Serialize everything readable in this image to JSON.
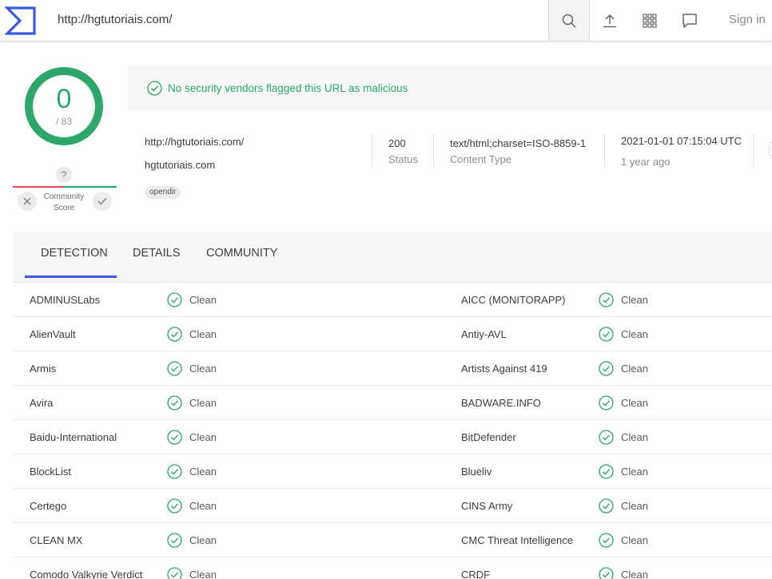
{
  "topbar": {
    "logo_icon": "virustotal-logo-icon",
    "url": "http://hgtutoriais.com/",
    "search_icon": "search-icon",
    "upload_icon": "upload-icon",
    "apps_icon": "grid-icon",
    "chat_icon": "chat-icon",
    "signin": "Sign in"
  },
  "score": {
    "value": "0",
    "total": "/ 83",
    "color": "#2fa46b"
  },
  "community": {
    "question": "?",
    "label_line1": "Community",
    "label_line2": "Score",
    "down_icon": "close-icon",
    "up_icon": "check-icon"
  },
  "banner": {
    "text": "No security vendors flagged this URL as malicious",
    "icon": "check-circle-icon"
  },
  "info": {
    "url": "http://hgtutoriais.com/",
    "domain": "hgtutoriais.com",
    "tag": "opendir",
    "status_value": "200",
    "status_label": "Status",
    "content_type_value": "text/html;charset=ISO-8859-1",
    "content_type_label": "Content Type",
    "date_value": "2021-01-01 07:15:04 UTC",
    "date_ago": "1 year ago"
  },
  "tabs": [
    {
      "label": "DETECTION"
    },
    {
      "label": "DETAILS"
    },
    {
      "label": "COMMUNITY"
    }
  ],
  "detections": [
    {
      "left": "ADMINUSLabs",
      "left_result": "Clean",
      "right": "AICC (MONITORAPP)",
      "right_result": "Clean"
    },
    {
      "left": "AlienVault",
      "left_result": "Clean",
      "right": "Antiy-AVL",
      "right_result": "Clean"
    },
    {
      "left": "Armis",
      "left_result": "Clean",
      "right": "Artists Against 419",
      "right_result": "Clean"
    },
    {
      "left": "Avira",
      "left_result": "Clean",
      "right": "BADWARE.INFO",
      "right_result": "Clean"
    },
    {
      "left": "Baidu-International",
      "left_result": "Clean",
      "right": "BitDefender",
      "right_result": "Clean"
    },
    {
      "left": "BlockList",
      "left_result": "Clean",
      "right": "Blueliv",
      "right_result": "Clean"
    },
    {
      "left": "Certego",
      "left_result": "Clean",
      "right": "CINS Army",
      "right_result": "Clean"
    },
    {
      "left": "CLEAN MX",
      "left_result": "Clean",
      "right": "CMC Threat Intelligence",
      "right_result": "Clean"
    },
    {
      "left": "Comodo Valkyrie Verdict",
      "left_result": "Clean",
      "right": "CRDF",
      "right_result": "Clean"
    }
  ]
}
